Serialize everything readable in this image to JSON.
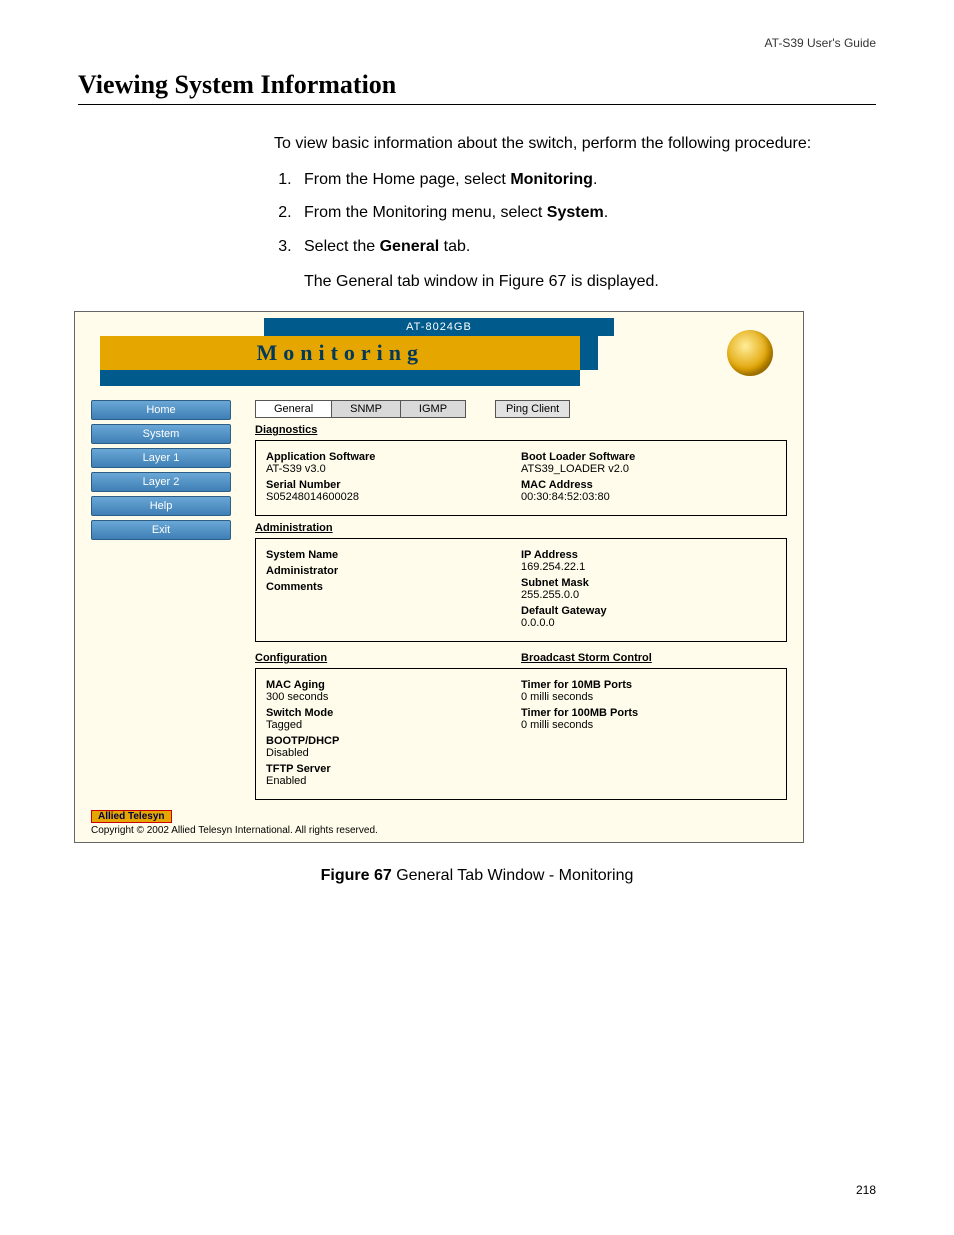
{
  "header": {
    "guide": "AT-S39 User's Guide"
  },
  "section_heading": "Viewing System Information",
  "intro": "To view basic information about the switch, perform the following procedure:",
  "steps": [
    {
      "pre": "From the Home page, select ",
      "strong": "Monitoring",
      "post": "."
    },
    {
      "pre": "From the Monitoring menu, select ",
      "strong": "System",
      "post": "."
    },
    {
      "pre": "Select the ",
      "strong": "General",
      "post": " tab."
    }
  ],
  "after_steps": "The General tab window in Figure 67 is displayed.",
  "figure": {
    "product": "AT-8024GB",
    "title": "Monitoring",
    "nav": [
      "Home",
      "System",
      "Layer 1",
      "Layer 2",
      "Help",
      "Exit"
    ],
    "tabs": {
      "active": "General",
      "others": [
        "SNMP",
        "IGMP"
      ],
      "pill": "Ping Client"
    },
    "diagnostics": {
      "heading": "Diagnostics",
      "left": [
        {
          "lab": "Application Software",
          "val": "AT-S39 v3.0"
        },
        {
          "lab": "Serial Number",
          "val": "S05248014600028"
        }
      ],
      "right": [
        {
          "lab": "Boot Loader Software",
          "val": "ATS39_LOADER v2.0"
        },
        {
          "lab": "MAC Address",
          "val": "00:30:84:52:03:80"
        }
      ]
    },
    "administration": {
      "heading": "Administration",
      "left": [
        {
          "lab": "System Name",
          "val": ""
        },
        {
          "lab": "Administrator",
          "val": ""
        },
        {
          "lab": "Comments",
          "val": ""
        }
      ],
      "right": [
        {
          "lab": "IP Address",
          "val": "169.254.22.1"
        },
        {
          "lab": "Subnet Mask",
          "val": "255.255.0.0"
        },
        {
          "lab": "Default Gateway",
          "val": "0.0.0.0"
        }
      ]
    },
    "config_heads": {
      "left": "Configuration",
      "right": "Broadcast Storm Control"
    },
    "config": {
      "left": [
        {
          "lab": "MAC Aging",
          "val": "300 seconds"
        },
        {
          "lab": "Switch Mode",
          "val": "Tagged"
        },
        {
          "lab": "BOOTP/DHCP",
          "val": "Disabled"
        },
        {
          "lab": "TFTP Server",
          "val": "Enabled"
        }
      ],
      "right": [
        {
          "lab": "Timer for 10MB Ports",
          "val": "0 milli seconds"
        },
        {
          "lab": "Timer for 100MB Ports",
          "val": "0 milli seconds"
        }
      ]
    },
    "footer_logo": "Allied Telesyn",
    "footer_copy": "Copyright © 2002 Allied Telesyn International. All rights reserved."
  },
  "caption_label": "Figure 67",
  "caption_text": "  General Tab Window - Monitoring",
  "page_number": "218"
}
